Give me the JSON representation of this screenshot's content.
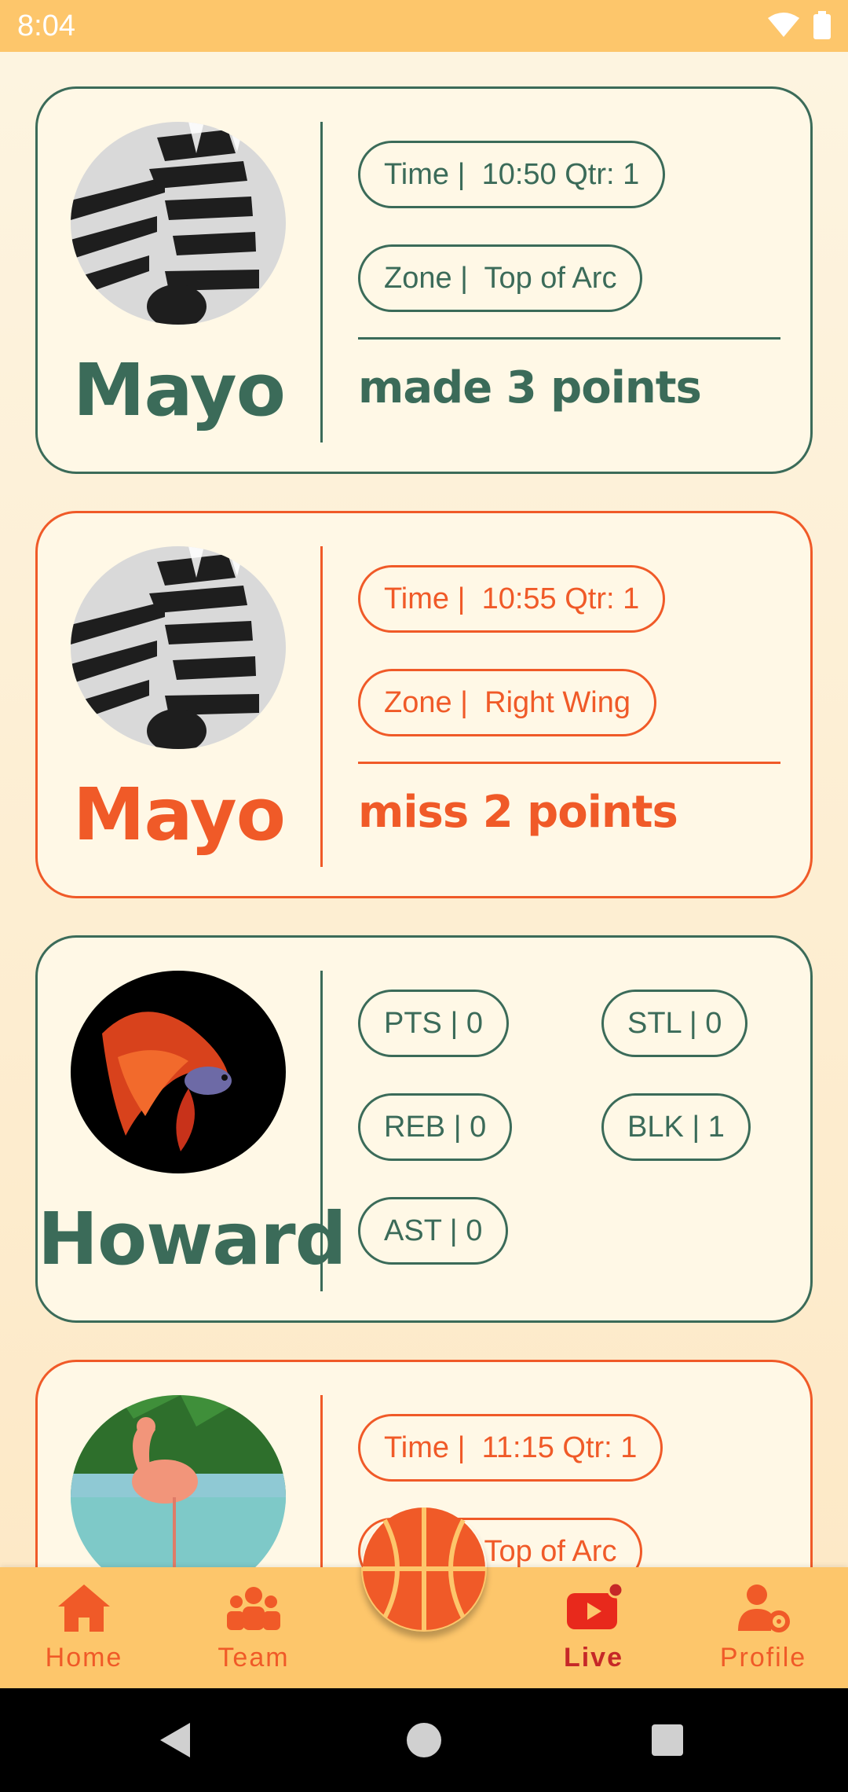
{
  "status_bar": {
    "time": "8:04"
  },
  "feed": {
    "cards": [
      {
        "kind": "play",
        "color": "green",
        "player": "Mayo",
        "avatar_icon": "zebra-avatar",
        "time_pill": "Time |  10:50 Qtr: 1",
        "zone_pill": "Zone |  Top of Arc",
        "action": "made 3 points"
      },
      {
        "kind": "play",
        "color": "orange",
        "player": "Mayo",
        "avatar_icon": "zebra-avatar",
        "time_pill": "Time |  10:55 Qtr: 1",
        "zone_pill": "Zone |  Right Wing",
        "action": "miss 2 points"
      },
      {
        "kind": "stats",
        "color": "green",
        "player": "Howard",
        "avatar_icon": "betta-fish-avatar",
        "stats": {
          "pts": "PTS | 0",
          "stl": "STL | 0",
          "reb": "REB | 0",
          "blk": "BLK | 1",
          "ast": "AST | 0"
        }
      },
      {
        "kind": "play",
        "color": "orange",
        "player": "",
        "avatar_icon": "flamingo-avatar",
        "time_pill": "Time |  11:15 Qtr: 1",
        "zone_pill": "Zone |  Top of Arc"
      }
    ]
  },
  "bottom_nav": {
    "items": [
      {
        "label": "Home",
        "icon": "home-icon"
      },
      {
        "label": "Team",
        "icon": "team-icon"
      },
      {
        "label": "Live",
        "icon": "live-icon",
        "active": true
      },
      {
        "label": "Profile",
        "icon": "profile-settings-icon"
      }
    ],
    "fab_icon": "basketball-icon"
  },
  "colors": {
    "green": "#3b6b59",
    "orange": "#f05a28",
    "nav_bg": "#fdc66b",
    "card_bg": "#fff8e6"
  }
}
